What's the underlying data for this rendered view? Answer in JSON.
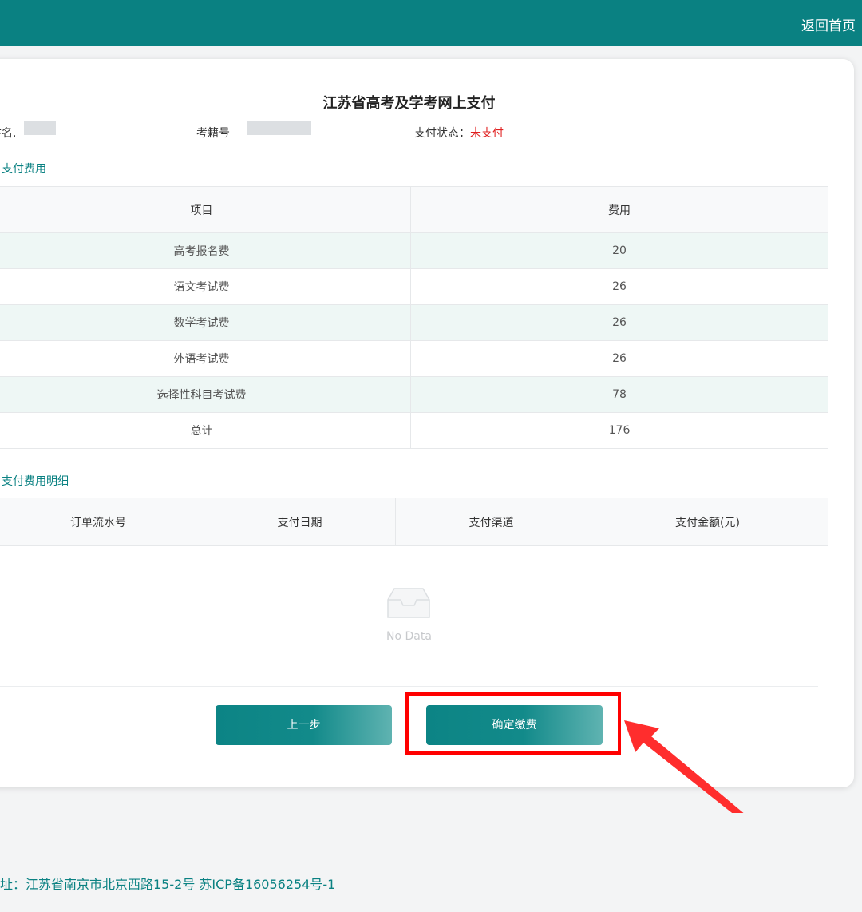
{
  "header": {
    "home_link": "返回首页"
  },
  "page": {
    "title": "江苏省高考及学考网上支付"
  },
  "info": {
    "name_label_partial": "姓名.",
    "exam_no_label": "考籍号",
    "pay_status_label": "支付状态：",
    "pay_status_value": "未支付"
  },
  "fees_section": {
    "title": "支付费用",
    "columns": [
      "项目",
      "费用"
    ],
    "rows": [
      {
        "item": "高考报名费",
        "fee": "20"
      },
      {
        "item": "语文考试费",
        "fee": "26"
      },
      {
        "item": "数学考试费",
        "fee": "26"
      },
      {
        "item": "外语考试费",
        "fee": "26"
      },
      {
        "item": "选择性科目考试费",
        "fee": "78"
      },
      {
        "item": "总计",
        "fee": "176"
      }
    ]
  },
  "details_section": {
    "title": "支付费用明细",
    "columns": [
      "订单流水号",
      "支付日期",
      "支付渠道",
      "支付金额(元)"
    ],
    "empty_text": "No Data"
  },
  "actions": {
    "prev_label": "上一步",
    "confirm_label": "确定缴费"
  },
  "footer": {
    "address": "址：江苏省南京市北京西路15-2号 苏ICP备16056254号-1"
  },
  "colors": {
    "brand": "#0a8182",
    "alert": "#e02020",
    "annotation": "#ff0000"
  }
}
